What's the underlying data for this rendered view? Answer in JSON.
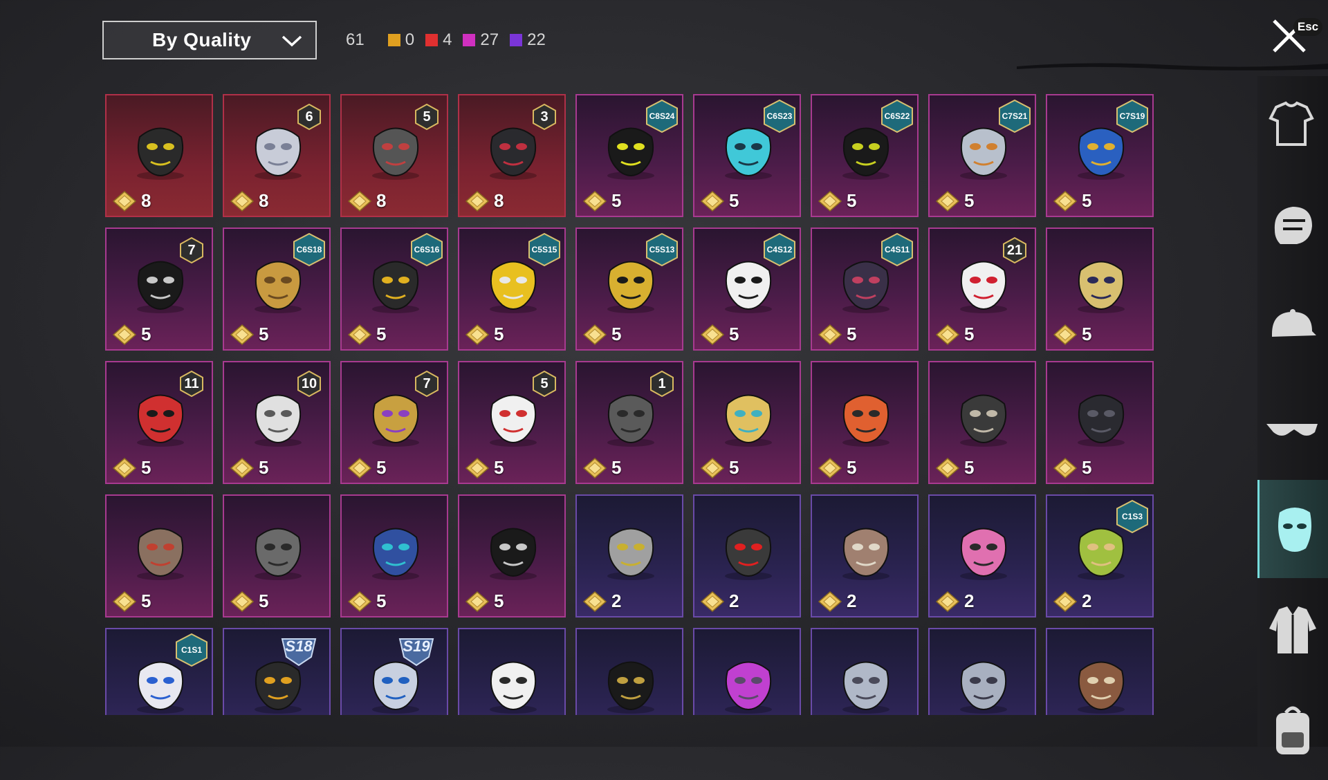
{
  "header": {
    "sort_label": "By Quality",
    "total": "61",
    "counts": [
      {
        "color": "#e0a020",
        "value": "0"
      },
      {
        "color": "#e03030",
        "value": "4"
      },
      {
        "color": "#d030c0",
        "value": "27"
      },
      {
        "color": "#7a35d8",
        "value": "22"
      }
    ],
    "esc_label": "Esc"
  },
  "items": [
    {
      "quality": "red",
      "cost": "8",
      "badge_type": "",
      "badge": "",
      "icon": "black-yellow-eyed-mask-icon",
      "c1": "#2a2a2a",
      "c2": "#d8c020"
    },
    {
      "quality": "red",
      "cost": "8",
      "badge_type": "num",
      "badge": "6",
      "icon": "plague-doctor-mask-icon",
      "c1": "#c8ccd8",
      "c2": "#7a8096"
    },
    {
      "quality": "red",
      "cost": "8",
      "badge_type": "num",
      "badge": "5",
      "icon": "gas-mask-icon",
      "c1": "#555",
      "c2": "#c04040"
    },
    {
      "quality": "red",
      "cost": "8",
      "badge_type": "num",
      "badge": "3",
      "icon": "wolf-mask-icon",
      "c1": "#2a2a2e",
      "c2": "#c03040"
    },
    {
      "quality": "pink",
      "cost": "5",
      "badge_type": "season",
      "badge": "C8S24",
      "icon": "yellow-visor-icon",
      "c1": "#1a1a1a",
      "c2": "#e0e020"
    },
    {
      "quality": "pink",
      "cost": "5",
      "badge_type": "season",
      "badge": "C6S23",
      "icon": "cyan-face-mask-icon",
      "c1": "#40c8d8",
      "c2": "#1a3a48"
    },
    {
      "quality": "pink",
      "cost": "5",
      "badge_type": "season",
      "badge": "C6S22",
      "icon": "black-face-mask-icon",
      "c1": "#1a1a1a",
      "c2": "#c8d020"
    },
    {
      "quality": "pink",
      "cost": "5",
      "badge_type": "season",
      "badge": "C7S21",
      "icon": "armored-mask-icon",
      "c1": "#b8c0cc",
      "c2": "#d08030"
    },
    {
      "quality": "pink",
      "cost": "5",
      "badge_type": "season",
      "badge": "C7S19",
      "icon": "blue-face-mask-icon",
      "c1": "#2a60c0",
      "c2": "#e0b030"
    },
    {
      "quality": "pink",
      "cost": "5",
      "badge_type": "num",
      "badge": "7",
      "icon": "thin-glasses-icon",
      "c1": "#1a1a1a",
      "c2": "#c8c8c8"
    },
    {
      "quality": "pink",
      "cost": "5",
      "badge_type": "season",
      "badge": "C6S18",
      "icon": "gold-horn-mask-icon",
      "c1": "#c89a40",
      "c2": "#6a4a20"
    },
    {
      "quality": "pink",
      "cost": "5",
      "badge_type": "season",
      "badge": "C6S16",
      "icon": "gold-respirator-icon",
      "c1": "#2a2a2a",
      "c2": "#e0b020"
    },
    {
      "quality": "pink",
      "cost": "5",
      "badge_type": "season",
      "badge": "C5S15",
      "icon": "bee-respirator-icon",
      "c1": "#e8c020",
      "c2": "#e8e8e8"
    },
    {
      "quality": "pink",
      "cost": "5",
      "badge_type": "season",
      "badge": "C5S13",
      "icon": "bandana-mask-icon",
      "c1": "#d8b030",
      "c2": "#1a1a1a"
    },
    {
      "quality": "pink",
      "cost": "5",
      "badge_type": "season",
      "badge": "C4S12",
      "icon": "teeth-mask-icon",
      "c1": "#f0f0f0",
      "c2": "#1a1a1a"
    },
    {
      "quality": "pink",
      "cost": "5",
      "badge_type": "season",
      "badge": "C4S11",
      "icon": "purple-face-mask-icon",
      "c1": "#3a3048",
      "c2": "#c04060"
    },
    {
      "quality": "pink",
      "cost": "5",
      "badge_type": "num",
      "badge": "21",
      "icon": "joker-mask-icon",
      "c1": "#f0f0f0",
      "c2": "#d02030"
    },
    {
      "quality": "pink",
      "cost": "5",
      "badge_type": "",
      "badge": "",
      "icon": "gold-helmet-mask-icon",
      "c1": "#d8c070",
      "c2": "#2a2a58"
    },
    {
      "quality": "pink",
      "cost": "5",
      "badge_type": "num",
      "badge": "11",
      "icon": "oni-mask-icon",
      "c1": "#d03030",
      "c2": "#1a1a1a"
    },
    {
      "quality": "pink",
      "cost": "5",
      "badge_type": "num",
      "badge": "10",
      "icon": "white-respirator-icon",
      "c1": "#e0e0e0",
      "c2": "#5a5a5a"
    },
    {
      "quality": "pink",
      "cost": "5",
      "badge_type": "num",
      "badge": "7",
      "icon": "gold-purple-mask-icon",
      "c1": "#c8a040",
      "c2": "#8a40c0"
    },
    {
      "quality": "pink",
      "cost": "5",
      "badge_type": "num",
      "badge": "5",
      "icon": "clown-mask-icon",
      "c1": "#f0f0f0",
      "c2": "#d03030"
    },
    {
      "quality": "pink",
      "cost": "5",
      "badge_type": "num",
      "badge": "1",
      "icon": "steel-skull-mask-icon",
      "c1": "#5a5a5a",
      "c2": "#2a2a2a"
    },
    {
      "quality": "pink",
      "cost": "5",
      "badge_type": "",
      "badge": "",
      "icon": "lion-dance-mask-icon",
      "c1": "#e0c060",
      "c2": "#40b0c0"
    },
    {
      "quality": "pink",
      "cost": "5",
      "badge_type": "",
      "badge": "",
      "icon": "orange-tech-mask-icon",
      "c1": "#e06030",
      "c2": "#2a2a2a"
    },
    {
      "quality": "pink",
      "cost": "5",
      "badge_type": "",
      "badge": "",
      "icon": "horned-respirator-icon",
      "c1": "#3a3a3a",
      "c2": "#c0b8a8"
    },
    {
      "quality": "pink",
      "cost": "5",
      "badge_type": "",
      "badge": "",
      "icon": "black-cat-mask-icon",
      "c1": "#2a2a30",
      "c2": "#5a5a66"
    },
    {
      "quality": "pink",
      "cost": "5",
      "badge_type": "",
      "badge": "",
      "icon": "bird-beak-mask-icon",
      "c1": "#8a7060",
      "c2": "#c04030"
    },
    {
      "quality": "pink",
      "cost": "5",
      "badge_type": "",
      "badge": "",
      "icon": "skull-face-mask-icon",
      "c1": "#6a6a6a",
      "c2": "#2a2a2a"
    },
    {
      "quality": "pink",
      "cost": "5",
      "badge_type": "",
      "badge": "",
      "icon": "galaxy-helmet-mask-icon",
      "c1": "#3050a0",
      "c2": "#30c0d0"
    },
    {
      "quality": "pink",
      "cost": "5",
      "badge_type": "",
      "badge": "",
      "icon": "skull-bandana-icon",
      "c1": "#1a1a1a",
      "c2": "#c8c8c8"
    },
    {
      "quality": "purple",
      "cost": "2",
      "badge_type": "",
      "badge": "",
      "icon": "hockey-mask-icon",
      "c1": "#a0a0a0",
      "c2": "#c8b030"
    },
    {
      "quality": "purple",
      "cost": "2",
      "badge_type": "",
      "badge": "",
      "icon": "red-eye-visor-icon",
      "c1": "#3a3a3a",
      "c2": "#e02020"
    },
    {
      "quality": "purple",
      "cost": "2",
      "badge_type": "",
      "badge": "",
      "icon": "mammoth-mask-icon",
      "c1": "#a08070",
      "c2": "#e0d8c8"
    },
    {
      "quality": "purple",
      "cost": "2",
      "badge_type": "",
      "badge": "",
      "icon": "pink-animal-mask-icon",
      "c1": "#e070b0",
      "c2": "#2a2a2a"
    },
    {
      "quality": "purple",
      "cost": "2",
      "badge_type": "season",
      "badge": "C1S3",
      "icon": "green-bandana-icon",
      "c1": "#a0c040",
      "c2": "#e0c080"
    },
    {
      "quality": "purple",
      "cost": "",
      "badge_type": "season",
      "badge": "C1S1",
      "icon": "blue-white-face-mask-icon",
      "c1": "#e8e8f0",
      "c2": "#2a60d0"
    },
    {
      "quality": "purple",
      "cost": "",
      "badge_type": "s",
      "badge": "S18",
      "icon": "heartbeat-mask-icon",
      "c1": "#2a2a2a",
      "c2": "#e0a020"
    },
    {
      "quality": "purple",
      "cost": "",
      "badge_type": "s",
      "badge": "S19",
      "icon": "blue-visor-mask-icon",
      "c1": "#c8d0e0",
      "c2": "#2060c0"
    },
    {
      "quality": "purple",
      "cost": "",
      "badge_type": "",
      "badge": "",
      "icon": "white-half-mask-icon",
      "c1": "#f0f0f0",
      "c2": "#2a2a2a"
    },
    {
      "quality": "purple",
      "cost": "",
      "badge_type": "",
      "badge": "",
      "icon": "black-bandana-icon",
      "c1": "#1a1a1a",
      "c2": "#c0a040"
    },
    {
      "quality": "purple",
      "cost": "",
      "badge_type": "",
      "badge": "",
      "icon": "purple-goggle-respirator-icon",
      "c1": "#c040d0",
      "c2": "#5a4a6a"
    },
    {
      "quality": "purple",
      "cost": "",
      "badge_type": "",
      "badge": "",
      "icon": "silver-helmet-mask-icon",
      "c1": "#b0b8c8",
      "c2": "#4a4a5a"
    },
    {
      "quality": "purple",
      "cost": "",
      "badge_type": "",
      "badge": "",
      "icon": "silver-skull-mask-icon",
      "c1": "#a8b0c0",
      "c2": "#3a3a4a"
    },
    {
      "quality": "purple",
      "cost": "",
      "badge_type": "",
      "badge": "",
      "icon": "dino-jaw-mask-icon",
      "c1": "#8a5a40",
      "c2": "#e0d0b0"
    }
  ],
  "sidebar": [
    {
      "icon": "outfit-icon",
      "active": false
    },
    {
      "icon": "head-icon",
      "active": false
    },
    {
      "icon": "hat-icon",
      "active": false
    },
    {
      "icon": "glasses-icon",
      "active": false
    },
    {
      "icon": "face-mask-icon",
      "active": true
    },
    {
      "icon": "jacket-icon",
      "active": false
    },
    {
      "icon": "backpack-icon",
      "active": false
    }
  ]
}
